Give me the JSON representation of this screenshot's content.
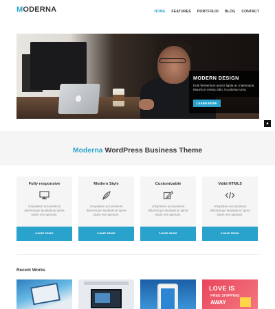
{
  "brand": {
    "m": "M",
    "rest": "ODERNA"
  },
  "nav": [
    {
      "label": "HOME",
      "active": true
    },
    {
      "label": "FEATURES",
      "active": false
    },
    {
      "label": "PORTFOLIO",
      "active": false
    },
    {
      "label": "BLOG",
      "active": false
    },
    {
      "label": "CONTACT",
      "active": false
    }
  ],
  "hero": {
    "title": "MODERN DESIGN",
    "text": "Duis fermentum auctor ligula ac malesuada. Mauris et metus odio, in pulvinar urna",
    "button": "LEARN MORE"
  },
  "band": {
    "accent": "Moderna",
    "title": " WordPress Business Theme",
    "totop": "▲"
  },
  "features": [
    {
      "title": "Fully responsive",
      "icon": "monitor-icon",
      "text": "Voluptatem accusantium doloremque laudantium sprea totam rem aperiam.",
      "button": "Learn more"
    },
    {
      "title": "Modern Style",
      "icon": "leaf-icon",
      "text": "Voluptatem accusantium doloremque laudantium sprea totam rem aperiam.",
      "button": "Learn more"
    },
    {
      "title": "Customizable",
      "icon": "edit-icon",
      "text": "Voluptatem accusantium doloremque laudantium sprea totam rem aperiam.",
      "button": "Learn more"
    },
    {
      "title": "Valid HTML5",
      "icon": "code-icon",
      "text": "Voluptatem accusantium doloremque laudantium sprea totam rem aperiam.",
      "button": "Learn more"
    }
  ],
  "recent": {
    "title": "Recent Works",
    "works": [
      {
        "label": ""
      },
      {
        "label": ""
      },
      {
        "label": ""
      },
      {
        "t1": "LOVE IS",
        "t2": "FREE SHIPPING",
        "t3": "AWAY"
      }
    ]
  },
  "colors": {
    "accent": "#2aa3cc",
    "dark": "#333333",
    "panel": "#f5f5f5"
  }
}
